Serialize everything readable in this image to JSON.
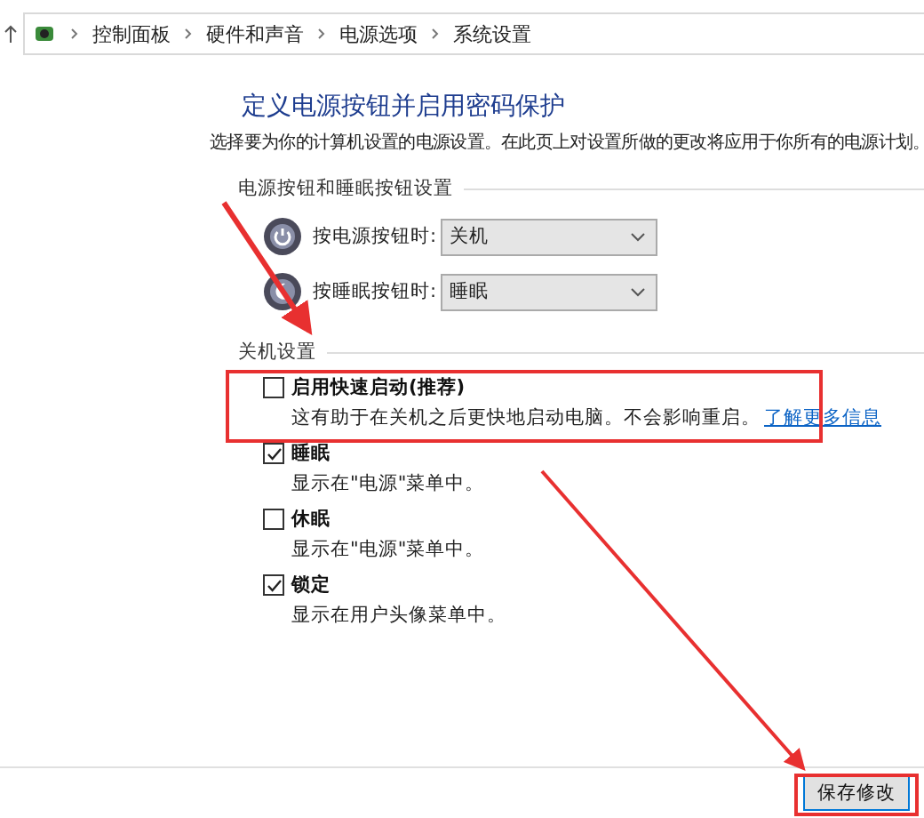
{
  "breadcrumb": [
    "控制面板",
    "硬件和声音",
    "电源选项",
    "系统设置"
  ],
  "title": "定义电源按钮并启用密码保护",
  "description": "选择要为你的计算机设置的电源设置。在此页上对设置所做的更改将应用于你所有的电源计划。",
  "power_section": {
    "heading": "电源按钮和睡眠按钮设置",
    "rows": [
      {
        "kind": "power",
        "label": "按电源按钮时:",
        "value": "关机"
      },
      {
        "kind": "sleep",
        "label": "按睡眠按钮时:",
        "value": "睡眠"
      }
    ]
  },
  "shutdown_section": {
    "heading": "关机设置",
    "items": [
      {
        "label": "启用快速启动(推荐)",
        "checked": false,
        "description": "这有助于在关机之后更快地启动电脑。不会影响重启。",
        "link": "了解更多信息"
      },
      {
        "label": "睡眠",
        "checked": true,
        "description": "显示在\"电源\"菜单中。"
      },
      {
        "label": "休眠",
        "checked": false,
        "description": "显示在\"电源\"菜单中。"
      },
      {
        "label": "锁定",
        "checked": true,
        "description": "显示在用户头像菜单中。"
      }
    ]
  },
  "save_button": "保存修改"
}
